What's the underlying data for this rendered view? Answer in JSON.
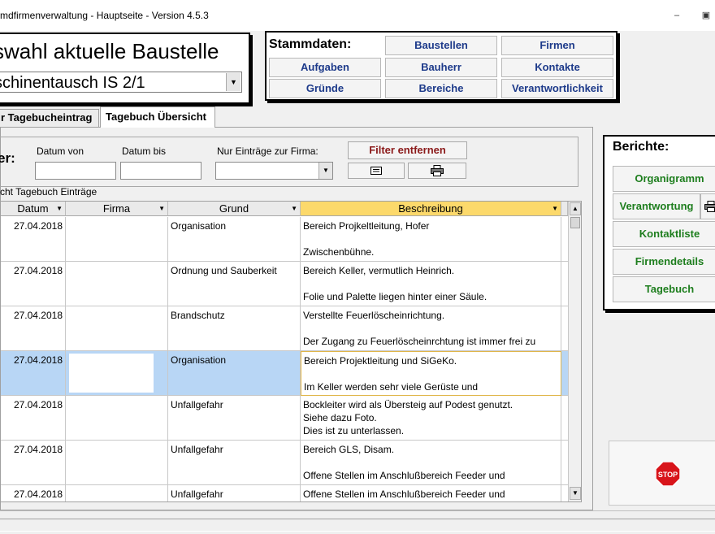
{
  "window": {
    "title": "mdfirmenverwaltung - Hauptseite - Version 4.5.3"
  },
  "baustelle": {
    "heading": "swahl aktuelle Baustelle",
    "selected": "schinentausch IS 2/1"
  },
  "stammdaten": {
    "label": "Stammdaten:",
    "buttons": [
      "Baustellen",
      "Firmen",
      "Aufgaben",
      "Bauherr",
      "Kontakte",
      "Gründe",
      "Bereiche",
      "Verantwortlichkeit"
    ]
  },
  "tabs": [
    "r Tagebucheintrag",
    "Tagebuch Übersicht"
  ],
  "filter": {
    "label": "er:",
    "datum_von_label": "Datum von",
    "datum_von_value": "",
    "datum_bis_label": "Datum bis",
    "datum_bis_value": "",
    "firma_label": "Nur Einträge zur Firma:",
    "firma_value": "",
    "remove_label": "Filter entfernen",
    "filter_color": "#8b1a1a"
  },
  "section_label": "cht Tagebuch Einträge",
  "grid": {
    "columns": [
      "Datum",
      "Firma",
      "Grund",
      "Beschreibung"
    ],
    "rows": [
      {
        "datum": "27.04.2018",
        "firma": "",
        "grund": "Organisation",
        "beschreibung": "Bereich Projkeltleitung, Hofer\n\nZwischenbühne."
      },
      {
        "datum": "27.04.2018",
        "firma": "",
        "grund": "Ordnung und Sauberkeit",
        "beschreibung": "Bereich Keller, vermutlich Heinrich.\n\nFolie und Palette liegen hinter einer Säule."
      },
      {
        "datum": "27.04.2018",
        "firma": "",
        "grund": "Brandschutz",
        "beschreibung": "Verstellte Feuerlöscheinrichtung.\n\nDer Zugang zu Feuerlöscheinrchtung ist immer frei zu"
      },
      {
        "datum": "27.04.2018",
        "firma": "",
        "grund": "Organisation",
        "beschreibung": "Bereich Projektleitung und SiGeKo.\n\nIm Keller werden sehr viele Gerüste und"
      },
      {
        "datum": "27.04.2018",
        "firma": "",
        "grund": "Unfallgefahr",
        "beschreibung": "Bockleiter wird als Übersteig auf Podest genutzt.\nSiehe dazu Foto.\nDies ist zu unterlassen."
      },
      {
        "datum": "27.04.2018",
        "firma": "",
        "grund": "Unfallgefahr",
        "beschreibung": "Bereich GLS, Disam.\n\nOffene Stellen im Anschlußbereich Feeder und"
      },
      {
        "datum": "27.04.2018",
        "firma": "",
        "grund": "Unfallgefahr",
        "beschreibung": "Offene Stellen im Anschlußbereich Feeder und"
      }
    ]
  },
  "berichte": {
    "label": "Berichte:",
    "buttons": [
      "Organigramm",
      "Verantwortung",
      "Kontaktliste",
      "Firmendetails",
      "Tagebuch"
    ]
  },
  "colors": {
    "stamm_text": "#1d3a8a",
    "berichte_text": "#1e7e1e",
    "selected_row": "#b8d6f5",
    "selected_header": "#fcd96b"
  }
}
